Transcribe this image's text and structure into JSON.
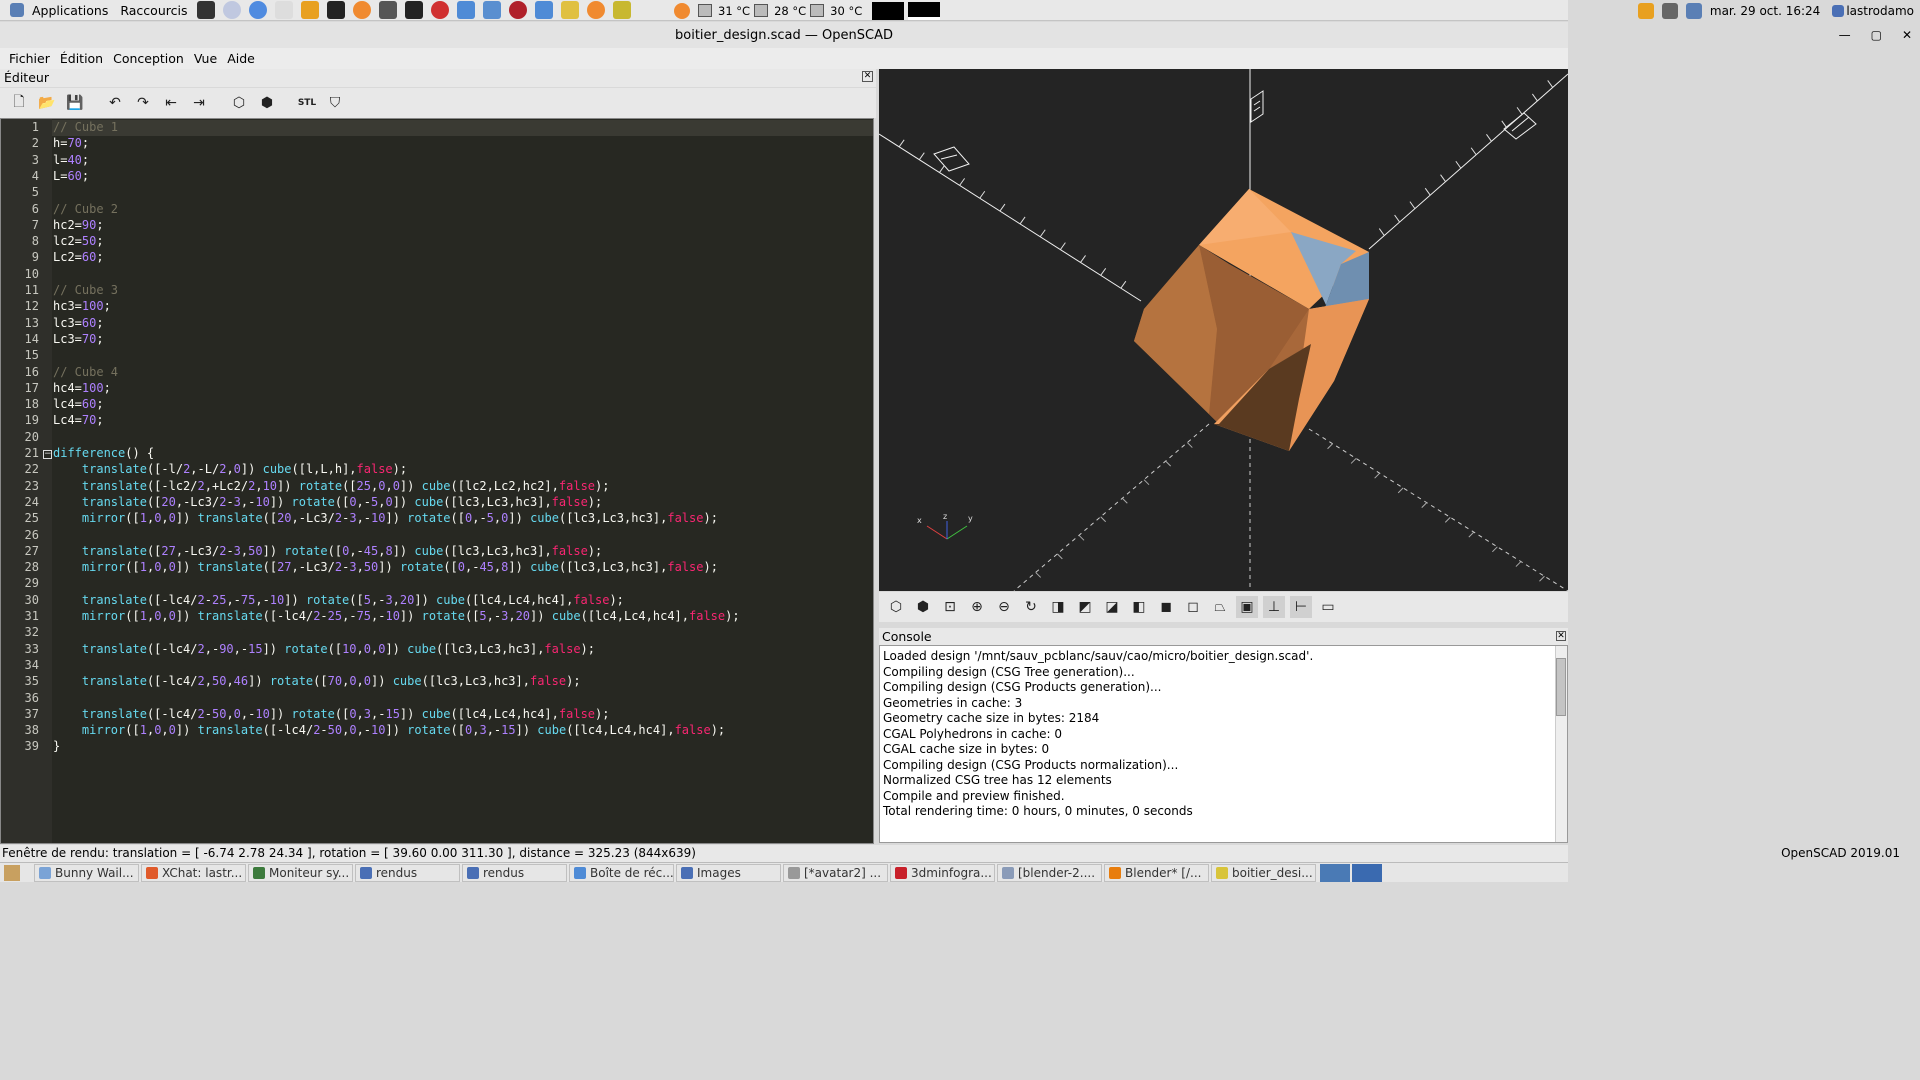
{
  "system_bar": {
    "applications": "Applications",
    "shortcuts": "Raccourcis",
    "temps": [
      "31 °C",
      "28 °C",
      "30 °C"
    ],
    "datetime": "mar. 29 oct. 16:24",
    "user": "lastrodamo"
  },
  "window": {
    "title": "boitier_design.scad — OpenSCAD"
  },
  "menu": [
    "Fichier",
    "Édition",
    "Conception",
    "Vue",
    "Aide"
  ],
  "editor": {
    "title": "Éditeur",
    "lines": [
      "// Cube 1",
      "h=70;",
      "l=40;",
      "L=60;",
      "",
      "// Cube 2",
      "hc2=90;",
      "lc2=50;",
      "Lc2=60;",
      "",
      "// Cube 3",
      "hc3=100;",
      "lc3=60;",
      "Lc3=70;",
      "",
      "// Cube 4",
      "hc4=100;",
      "lc4=60;",
      "Lc4=70;",
      "",
      "difference() {",
      "    translate([-l/2,-L/2,0]) cube([l,L,h],false);",
      "    translate([-lc2/2,+Lc2/2,10]) rotate([25,0,0]) cube([lc2,Lc2,hc2],false);",
      "    translate([20,-Lc3/2-3,-10]) rotate([0,-5,0]) cube([lc3,Lc3,hc3],false);",
      "    mirror([1,0,0]) translate([20,-Lc3/2-3,-10]) rotate([0,-5,0]) cube([lc3,Lc3,hc3],false);",
      "",
      "    translate([27,-Lc3/2-3,50]) rotate([0,-45,8]) cube([lc3,Lc3,hc3],false);",
      "    mirror([1,0,0]) translate([27,-Lc3/2-3,50]) rotate([0,-45,8]) cube([lc3,Lc3,hc3],false);",
      "",
      "    translate([-lc4/2-25,-75,-10]) rotate([5,-3,20]) cube([lc4,Lc4,hc4],false);",
      "    mirror([1,0,0]) translate([-lc4/2-25,-75,-10]) rotate([5,-3,20]) cube([lc4,Lc4,hc4],false);",
      "",
      "    translate([-lc4/2,-90,-15]) rotate([10,0,0]) cube([lc3,Lc3,hc3],false);",
      "",
      "    translate([-lc4/2,50,46]) rotate([70,0,0]) cube([lc3,Lc3,hc3],false);",
      "",
      "    translate([-lc4/2-50,0,-10]) rotate([0,3,-15]) cube([lc4,Lc4,hc4],false);",
      "    mirror([1,0,0]) translate([-lc4/2-50,0,-10]) rotate([0,3,-15]) cube([lc4,Lc4,hc4],false);",
      "}"
    ]
  },
  "viewer": {
    "axis_labels": {
      "x": "x",
      "y": "y",
      "z": "z"
    }
  },
  "console": {
    "title": "Console",
    "lines": [
      "Loaded design '/mnt/sauv_pcblanc/sauv/cao/micro/boitier_design.scad'.",
      "Compiling design (CSG Tree generation)...",
      "Compiling design (CSG Products generation)...",
      "Geometries in cache: 3",
      "Geometry cache size in bytes: 2184",
      "CGAL Polyhedrons in cache: 0",
      "CGAL cache size in bytes: 0",
      "Compiling design (CSG Products normalization)...",
      "Normalized CSG tree has 12 elements",
      "Compile and preview finished.",
      "Total rendering time: 0 hours, 0 minutes, 0 seconds"
    ]
  },
  "status": {
    "left": "Fenêtre de rendu: translation = [ -6.74 2.78 24.34 ], rotation = [ 39.60 0.00 311.30 ], distance = 325.23 (844x639)",
    "right": "OpenSCAD 2019.01"
  },
  "taskbar": [
    {
      "label": "Bunny Wail...",
      "color": "#7aa3d6"
    },
    {
      "label": "XChat: lastr...",
      "color": "#e05a2a"
    },
    {
      "label": "Moniteur sy...",
      "color": "#3c7a3c"
    },
    {
      "label": "rendus",
      "color": "#4a6fb5"
    },
    {
      "label": "rendus",
      "color": "#4a6fb5"
    },
    {
      "label": "Boîte de réc...",
      "color": "#4f8bd6"
    },
    {
      "label": "Images",
      "color": "#4a6fb5"
    },
    {
      "label": "[*avatar2] ...",
      "color": "#999999"
    },
    {
      "label": "3dminfogra...",
      "color": "#c8202a"
    },
    {
      "label": "[blender-2....",
      "color": "#8a9bb8"
    },
    {
      "label": "Blender* [/...",
      "color": "#e87d0d"
    },
    {
      "label": "boitier_desi...",
      "color": "#d8c43a"
    }
  ],
  "colors": {
    "editor_bg": "#272822",
    "model_light": "#f4a460",
    "model_dark": "#5a3a20",
    "model_cut": "#6f8fb0"
  }
}
